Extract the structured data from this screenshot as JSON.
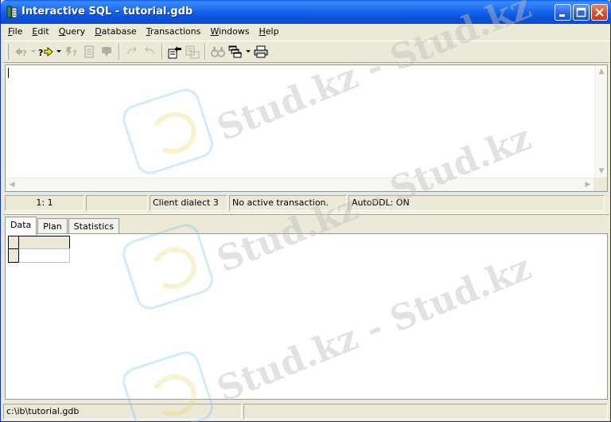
{
  "window": {
    "title": "Interactive SQL - tutorial.gdb",
    "accent": "#0a55dc",
    "close_color": "#d5522e"
  },
  "menu": [
    {
      "label": "File",
      "accel": "F",
      "rest": "ile"
    },
    {
      "label": "Edit",
      "accel": "E",
      "rest": "dit"
    },
    {
      "label": "Query",
      "accel": "Q",
      "rest": "uery"
    },
    {
      "label": "Database",
      "accel": "D",
      "rest": "atabase"
    },
    {
      "label": "Transactions",
      "accel": "T",
      "rest": "ransactions"
    },
    {
      "label": "Windows",
      "accel": "W",
      "rest": "indows"
    },
    {
      "label": "Help",
      "accel": "H",
      "rest": "elp"
    }
  ],
  "toolbar": {
    "icons": [
      "previous-query-icon",
      "next-query-icon",
      "execute-query-icon",
      "prepare-icon",
      "commit-icon",
      "redo-icon",
      "undo-icon",
      "load-script-icon",
      "save-script-icon",
      "find-icon",
      "cascade-icon",
      "print-icon"
    ]
  },
  "editor": {
    "text": ""
  },
  "editor_status": {
    "position": "1:  1",
    "empty": "",
    "dialect": "Client dialect 3",
    "transaction": "No active transaction.",
    "autoddl": "AutoDDL: ON"
  },
  "tabs": [
    {
      "label": "Data",
      "active": true
    },
    {
      "label": "Plan",
      "active": false
    },
    {
      "label": "Statistics",
      "active": false
    }
  ],
  "status": {
    "path": "c:\\ib\\tutorial.gdb",
    "extra": ""
  },
  "watermark": {
    "text": "Stud.kz - Stud.kz"
  }
}
